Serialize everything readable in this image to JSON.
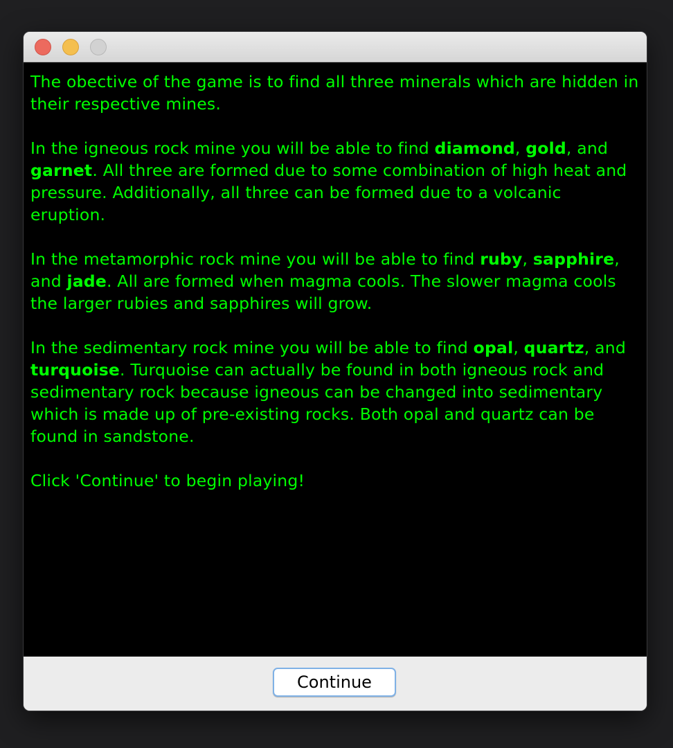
{
  "window": {
    "title": ""
  },
  "intro": {
    "p1": {
      "text": "The obective of the game is to find all three minerals which are hidden in their respective mines."
    },
    "p2": {
      "prefix": "In the igneous rock mine you will be able to find ",
      "m1": "diamond",
      "sep1": ", ",
      "m2": "gold",
      "sep2": ", and ",
      "m3": "garnet",
      "suffix": ". All three are formed due to some combination of high heat and pressure. Additionally, all three can be formed due to a volcanic eruption."
    },
    "p3": {
      "prefix": "In the metamorphic rock mine you will be able to find ",
      "m1": "ruby",
      "sep1": ", ",
      "m2": "sapphire",
      "sep2": ", and ",
      "m3": "jade",
      "suffix": ". All are formed when magma cools. The slower magma cools the larger rubies and sapphires will grow."
    },
    "p4": {
      "prefix": "In the sedimentary rock mine you will be able to find ",
      "m1": "opal",
      "sep1": ", ",
      "m2": "quartz",
      "sep2": ", and ",
      "m3": "turquoise",
      "suffix": ". Turquoise can actually be found in both igneous rock and sedimentary rock because igneous can be changed into sedimentary which is made up of pre-existing rocks. Both opal and quartz can be found in sandstone."
    },
    "p5": {
      "text": "Click 'Continue' to begin playing!"
    }
  },
  "footer": {
    "continue_label": "Continue"
  },
  "colors": {
    "text": "#00ff00",
    "background": "#000000",
    "button_focus_ring": "#7fb1e6"
  }
}
